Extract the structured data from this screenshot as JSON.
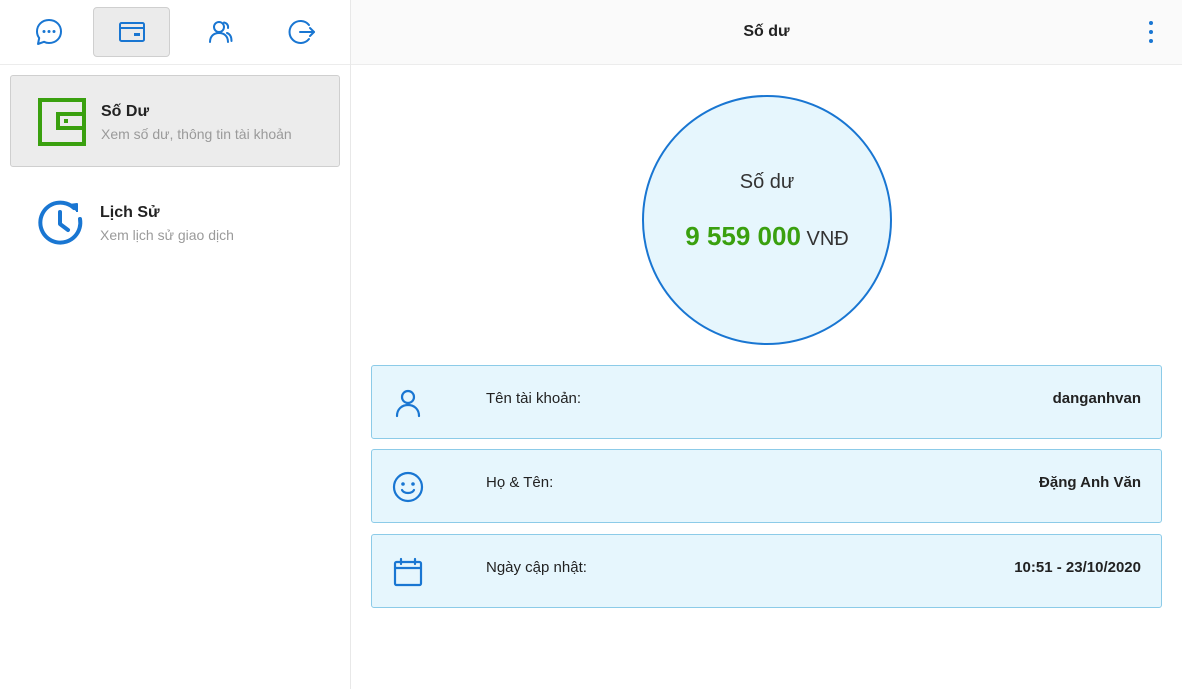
{
  "colors": {
    "accent": "#1976d2",
    "green": "#3aa00f",
    "card_bg": "#e6f6fd",
    "card_border": "#8ccbe8"
  },
  "top_nav": [
    {
      "icon": "chat-icon"
    },
    {
      "icon": "wallet-card-icon",
      "active": true
    },
    {
      "icon": "user-group-icon"
    },
    {
      "icon": "logout-icon"
    }
  ],
  "sidebar": {
    "items": [
      {
        "icon": "wallet-icon",
        "title": "Số Dư",
        "subtitle": "Xem số dư, thông tin tài khoản",
        "active": true
      },
      {
        "icon": "history-clock-icon",
        "title": "Lịch Sử",
        "subtitle": "Xem lịch sử giao dịch"
      }
    ]
  },
  "header": {
    "title": "Số dư"
  },
  "balance": {
    "label": "Số dư",
    "amount": "9 559 000",
    "currency": "VNĐ"
  },
  "info": [
    {
      "icon": "user-icon",
      "label": "Tên tài khoản:",
      "value": "danganhvan"
    },
    {
      "icon": "smile-icon",
      "label": "Họ & Tên:",
      "value": "Đặng Anh Văn"
    },
    {
      "icon": "calendar-icon",
      "label": "Ngày cập nhật:",
      "value": "10:51 - 23/10/2020"
    }
  ]
}
